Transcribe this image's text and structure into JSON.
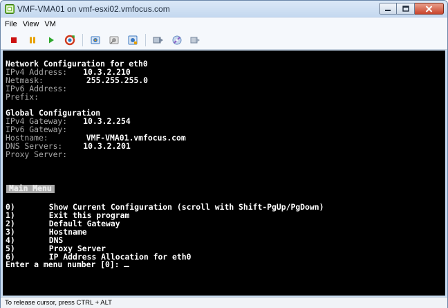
{
  "window": {
    "title": "VMF-VMA01 on vmf-esxi02.vmfocus.com"
  },
  "menubar": {
    "items": [
      "File",
      "View",
      "VM"
    ]
  },
  "toolbar": {
    "buttons": [
      {
        "name": "power-off-icon",
        "color": "#cc1111"
      },
      {
        "name": "suspend-icon",
        "color": "#e8a000"
      },
      {
        "name": "power-on-icon",
        "color": "#2da82d"
      },
      {
        "name": "reset-icon",
        "color": "#d03a1e"
      },
      {
        "name": "snapshot-icon",
        "color": "#3a78c2"
      },
      {
        "name": "revert-snapshot-icon",
        "color": "#8a8a8a"
      },
      {
        "name": "snapshot-manager-icon",
        "color": "#3a78c2"
      },
      {
        "name": "vm-settings-icon",
        "color": "#7a8aa0"
      },
      {
        "name": "connect-devices-icon",
        "color": "#6a8fc4"
      },
      {
        "name": "console-options-icon",
        "color": "#7a8aa0"
      }
    ]
  },
  "console": {
    "net_config": {
      "heading": "Network Configuration for eth0",
      "ipv4_label": "IPv4 Address:",
      "ipv4_value": "10.3.2.210",
      "netmask_label": "Netmask:",
      "netmask_value": "255.255.255.0",
      "ipv6_label": "IPv6 Address:",
      "prefix_label": "Prefix:"
    },
    "global_config": {
      "heading": "Global Configuration",
      "ipv4_gw_label": "IPv4 Gateway:",
      "ipv4_gw_value": "10.3.2.254",
      "ipv6_gw_label": "IPv6 Gateway:",
      "hostname_label": "Hostname:",
      "hostname_value": "VMF-VMA01.vmfocus.com",
      "dns_label": "DNS Servers:",
      "dns_value": "10.3.2.201",
      "proxy_label": "Proxy Server:"
    },
    "main_menu_label": "Main Menu",
    "menu_options": [
      {
        "num": "0)",
        "text": "Show Current Configuration (scroll with Shift-PgUp/PgDown)"
      },
      {
        "num": "1)",
        "text": "Exit this program"
      },
      {
        "num": "2)",
        "text": "Default Gateway"
      },
      {
        "num": "3)",
        "text": "Hostname"
      },
      {
        "num": "4)",
        "text": "DNS"
      },
      {
        "num": "5)",
        "text": "Proxy Server"
      },
      {
        "num": "6)",
        "text": "IP Address Allocation for eth0"
      }
    ],
    "prompt": "Enter a menu number [0]:"
  },
  "statusbar": {
    "text": "To release cursor, press CTRL + ALT"
  }
}
